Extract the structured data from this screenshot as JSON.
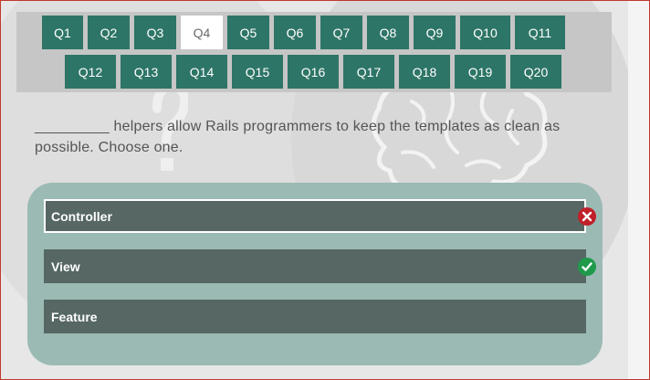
{
  "questions_nav": {
    "row1": [
      "Q1",
      "Q2",
      "Q3",
      "Q4",
      "Q5",
      "Q6",
      "Q7",
      "Q8",
      "Q9",
      "Q10",
      "Q11"
    ],
    "row2": [
      "Q12",
      "Q13",
      "Q14",
      "Q15",
      "Q16",
      "Q17",
      "Q18",
      "Q19",
      "Q20"
    ],
    "active": "Q4"
  },
  "question": {
    "text": "_________ helpers allow Rails programmers to keep the templates as clean as possible. Choose one."
  },
  "answers": [
    {
      "label": "Controller",
      "status": "incorrect-selected"
    },
    {
      "label": "View",
      "status": "correct"
    },
    {
      "label": "Feature",
      "status": "none"
    }
  ],
  "icons": {
    "wrong": "close-circle-icon",
    "right": "check-circle-icon",
    "background": [
      "question-mark-icon",
      "brain-icon"
    ]
  },
  "colors": {
    "nav_button": "#2d7566",
    "nav_button_active": "#ffffff",
    "answer_panel": "#9bbab4",
    "answer_button": "#566764",
    "wrong": "#c0202a",
    "right": "#1f9a4b"
  }
}
